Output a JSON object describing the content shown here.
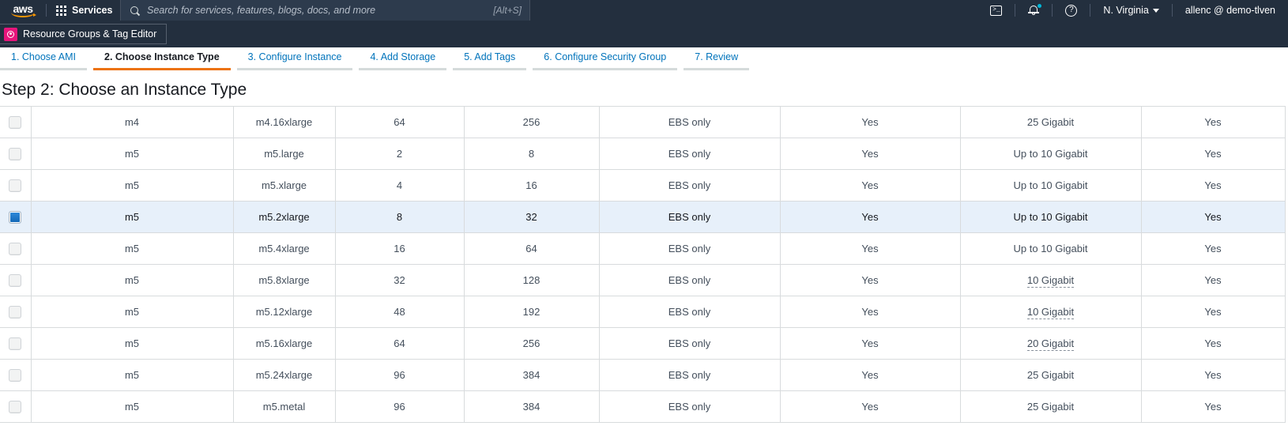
{
  "top_nav": {
    "logo_text": "aws",
    "services_label": "Services",
    "search": {
      "placeholder": "Search for services, features, blogs, docs, and more",
      "value": "",
      "hint": "[Alt+S]"
    },
    "cloudshell_icon": "terminal-icon",
    "notifications_icon": "bell-icon",
    "help_icon": "help-circle-icon",
    "region_label": "N. Virginia",
    "account_label": "allenc @ demo-tlven"
  },
  "second_bar": {
    "resource_groups_tab": "Resource Groups & Tag Editor",
    "resource_groups_icon": "resource-groups-icon"
  },
  "wizard": {
    "tabs": [
      {
        "label": "1. Choose AMI",
        "active": false
      },
      {
        "label": "2. Choose Instance Type",
        "active": true
      },
      {
        "label": "3. Configure Instance",
        "active": false
      },
      {
        "label": "4. Add Storage",
        "active": false
      },
      {
        "label": "5. Add Tags",
        "active": false
      },
      {
        "label": "6. Configure Security Group",
        "active": false
      },
      {
        "label": "7. Review",
        "active": false
      }
    ]
  },
  "page": {
    "title": "Step 2: Choose an Instance Type"
  },
  "colors": {
    "nav_background": "#232f3e",
    "accent_orange": "#ec7211",
    "link_blue": "#0073bb",
    "selected_row": "#e7f0fa",
    "checkbox_blue": "#1266b5",
    "resource_groups_pink": "#e7157b"
  },
  "table": {
    "rows": [
      {
        "selected": false,
        "family": "m4",
        "type": "m4.16xlarge",
        "vcpus": "64",
        "memory": "256",
        "instance_storage": "EBS only",
        "ebs_optimized": "Yes",
        "network_performance": "25 Gigabit",
        "network_tooltip": false,
        "ipv6_support": "Yes"
      },
      {
        "selected": false,
        "family": "m5",
        "type": "m5.large",
        "vcpus": "2",
        "memory": "8",
        "instance_storage": "EBS only",
        "ebs_optimized": "Yes",
        "network_performance": "Up to 10 Gigabit",
        "network_tooltip": false,
        "ipv6_support": "Yes"
      },
      {
        "selected": false,
        "family": "m5",
        "type": "m5.xlarge",
        "vcpus": "4",
        "memory": "16",
        "instance_storage": "EBS only",
        "ebs_optimized": "Yes",
        "network_performance": "Up to 10 Gigabit",
        "network_tooltip": false,
        "ipv6_support": "Yes"
      },
      {
        "selected": true,
        "family": "m5",
        "type": "m5.2xlarge",
        "vcpus": "8",
        "memory": "32",
        "instance_storage": "EBS only",
        "ebs_optimized": "Yes",
        "network_performance": "Up to 10 Gigabit",
        "network_tooltip": false,
        "ipv6_support": "Yes"
      },
      {
        "selected": false,
        "family": "m5",
        "type": "m5.4xlarge",
        "vcpus": "16",
        "memory": "64",
        "instance_storage": "EBS only",
        "ebs_optimized": "Yes",
        "network_performance": "Up to 10 Gigabit",
        "network_tooltip": false,
        "ipv6_support": "Yes"
      },
      {
        "selected": false,
        "family": "m5",
        "type": "m5.8xlarge",
        "vcpus": "32",
        "memory": "128",
        "instance_storage": "EBS only",
        "ebs_optimized": "Yes",
        "network_performance": "10 Gigabit",
        "network_tooltip": true,
        "ipv6_support": "Yes"
      },
      {
        "selected": false,
        "family": "m5",
        "type": "m5.12xlarge",
        "vcpus": "48",
        "memory": "192",
        "instance_storage": "EBS only",
        "ebs_optimized": "Yes",
        "network_performance": "10 Gigabit",
        "network_tooltip": true,
        "ipv6_support": "Yes"
      },
      {
        "selected": false,
        "family": "m5",
        "type": "m5.16xlarge",
        "vcpus": "64",
        "memory": "256",
        "instance_storage": "EBS only",
        "ebs_optimized": "Yes",
        "network_performance": "20 Gigabit",
        "network_tooltip": true,
        "ipv6_support": "Yes"
      },
      {
        "selected": false,
        "family": "m5",
        "type": "m5.24xlarge",
        "vcpus": "96",
        "memory": "384",
        "instance_storage": "EBS only",
        "ebs_optimized": "Yes",
        "network_performance": "25 Gigabit",
        "network_tooltip": false,
        "ipv6_support": "Yes"
      },
      {
        "selected": false,
        "family": "m5",
        "type": "m5.metal",
        "vcpus": "96",
        "memory": "384",
        "instance_storage": "EBS only",
        "ebs_optimized": "Yes",
        "network_performance": "25 Gigabit",
        "network_tooltip": false,
        "ipv6_support": "Yes"
      }
    ]
  }
}
